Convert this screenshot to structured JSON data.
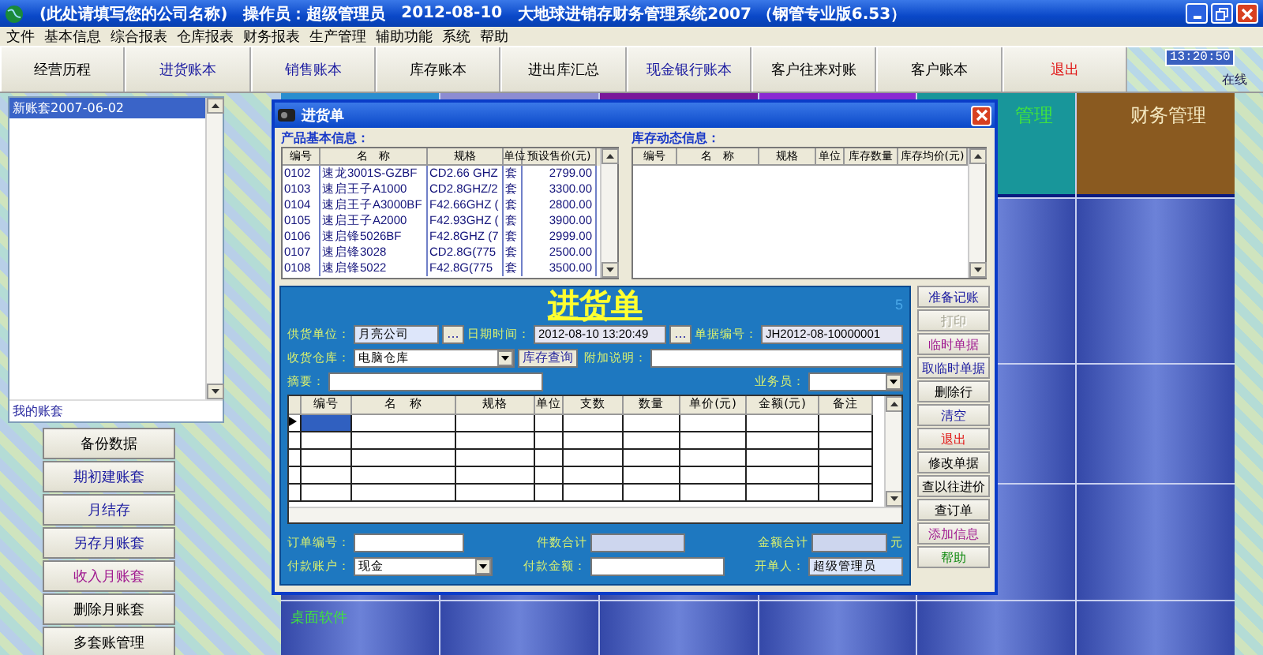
{
  "title_bar": {
    "company": "(此处请填写您的公司名称)",
    "operator": "操作员：超级管理员",
    "date": "2012-08-10",
    "app_name": "大地球进销存财务管理系统2007 （钢管专业版6.53）"
  },
  "menu": [
    "文件",
    "基本信息",
    "综合报表",
    "仓库报表",
    "财务报表",
    "生产管理",
    "辅助功能",
    "系统",
    "帮助"
  ],
  "toolbar": {
    "buttons": [
      {
        "label": "经营历程",
        "color": "#000000"
      },
      {
        "label": "进货账本",
        "color": "#1a1aa0"
      },
      {
        "label": "销售账本",
        "color": "#1a1aa0"
      },
      {
        "label": "库存账本",
        "color": "#000000"
      },
      {
        "label": "进出库汇总",
        "color": "#000000"
      },
      {
        "label": "现金银行账本",
        "color": "#1a1aa0"
      },
      {
        "label": "客户往来对账",
        "color": "#000000"
      },
      {
        "label": "客户账本",
        "color": "#000000"
      },
      {
        "label": "退出",
        "color": "#e01010"
      }
    ],
    "clock": "13:20:50",
    "status": "在线"
  },
  "account_panel": {
    "items": [
      {
        "label": "新账套2007-06-02",
        "selected": true
      }
    ],
    "caption": "我的账套",
    "buttons": [
      {
        "label": "备份数据",
        "color": "#000000"
      },
      {
        "label": "期初建账套",
        "color": "#1a1aa0"
      },
      {
        "label": "月结存",
        "color": "#1a1aa0"
      },
      {
        "label": "另存月账套",
        "color": "#1a1aa0"
      },
      {
        "label": "收入月账套",
        "color": "#a01a90"
      },
      {
        "label": "删除月账套",
        "color": "#000000"
      },
      {
        "label": "多套账管理",
        "color": "#000000"
      }
    ]
  },
  "desktop": {
    "top_tiles": [
      {
        "color": "#2a8ecf"
      },
      {
        "color": "#8c8cd2"
      },
      {
        "color": "#7a189a"
      },
      {
        "color": "#8a2ad2"
      },
      {
        "color": "#18969a",
        "label": "管理"
      },
      {
        "color": "#8a5a20",
        "label": "财务管理"
      }
    ],
    "bottom_label": "桌面软件"
  },
  "dialog": {
    "title": "进货单",
    "products": {
      "label": "产品基本信息：",
      "columns": [
        "编号",
        "名　称",
        "规格",
        "单位",
        "预设售价(元)"
      ],
      "rows": [
        [
          "0102",
          "速龙3001S-GZBF",
          "CD2.66 GHZ",
          "套",
          "2799.00"
        ],
        [
          "0103",
          "速启王子A1000",
          "CD2.8GHZ/2",
          "套",
          "3300.00"
        ],
        [
          "0104",
          "速启王子A3000BF",
          "F42.66GHZ (",
          "套",
          "2800.00"
        ],
        [
          "0105",
          "速启王子A2000",
          "F42.93GHZ (",
          "套",
          "3900.00"
        ],
        [
          "0106",
          "速启锋5026BF",
          "F42.8GHZ (7",
          "套",
          "2999.00"
        ],
        [
          "0107",
          "速启锋3028",
          "CD2.8G(775",
          "套",
          "2500.00"
        ],
        [
          "0108",
          "速启锋5022",
          "F42.8G(775",
          "套",
          "3500.00"
        ]
      ]
    },
    "stock": {
      "label": "库存动态信息：",
      "columns": [
        "编号",
        "名　称",
        "规格",
        "单位",
        "库存数量",
        "库存均价(元)"
      ]
    },
    "form": {
      "heading": "进货单",
      "corner_number": "5",
      "supplier": {
        "label": "供货单位：",
        "value": "月亮公司",
        "button": "..."
      },
      "datetime": {
        "label": "日期时间：",
        "value": "2012-08-10 13:20:49",
        "button": "..."
      },
      "doc_number": {
        "label": "单据编号：",
        "value": "JH2012-08-10000001"
      },
      "warehouse": {
        "label": "收货仓库：",
        "value": "电脑仓库"
      },
      "stock_query_button": "库存查询",
      "note": {
        "label": "附加说明："
      },
      "summary": {
        "label": "摘要："
      },
      "clerk": {
        "label": "业务员："
      },
      "grid": {
        "columns": [
          "编号",
          "名　称",
          "规格",
          "单位",
          "支数",
          "数量",
          "单价(元)",
          "金额(元)",
          "备注"
        ]
      },
      "order_number": {
        "label": "订单编号："
      },
      "piece_total": {
        "label": "件数合计"
      },
      "amount_total": {
        "label": "金额合计",
        "unit": "元"
      },
      "pay_account": {
        "label": "付款账户：",
        "value": "现金"
      },
      "pay_amount": {
        "label": "付款金额："
      },
      "issuer": {
        "label": "开单人：",
        "value": "超级管理员"
      }
    },
    "buttons": [
      {
        "label": "准备记账",
        "color": "#1a1aa0",
        "disabled": false
      },
      {
        "label": "打印",
        "color": "#a8a898",
        "disabled": true
      },
      {
        "label": "临时单据",
        "color": "#a01a90",
        "disabled": false
      },
      {
        "label": "取临时单据",
        "color": "#1a1aa0",
        "disabled": false
      },
      {
        "label": "删除行",
        "color": "#000000",
        "disabled": false
      },
      {
        "label": "清空",
        "color": "#1a1aa0",
        "disabled": false
      },
      {
        "label": "退出",
        "color": "#e01010",
        "disabled": false
      },
      {
        "label": "修改单据",
        "color": "#000000",
        "disabled": false
      },
      {
        "label": "查以往进价",
        "color": "#000000",
        "disabled": false
      },
      {
        "label": "查订单",
        "color": "#000000",
        "disabled": false
      },
      {
        "label": "添加信息",
        "color": "#a01a90",
        "disabled": false
      },
      {
        "label": "帮助",
        "color": "#108a10",
        "disabled": false
      }
    ]
  }
}
